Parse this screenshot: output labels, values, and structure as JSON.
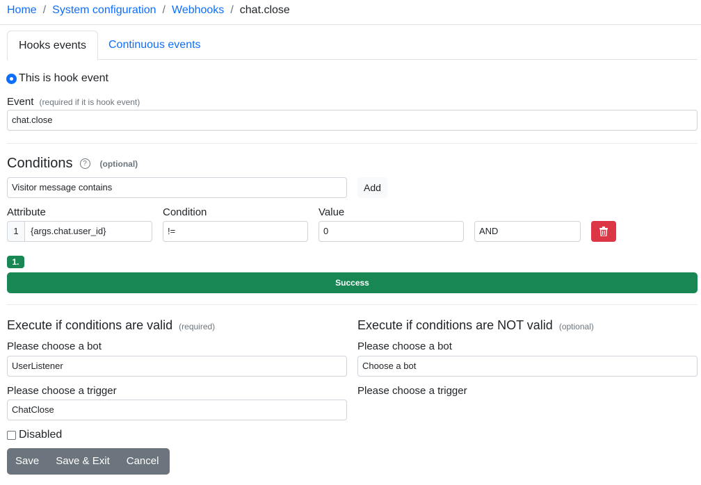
{
  "breadcrumb": {
    "items": [
      "Home",
      "System configuration",
      "Webhooks"
    ],
    "current": "chat.close"
  },
  "tabs": [
    {
      "label": "Hooks events",
      "active": true
    },
    {
      "label": "Continuous events",
      "active": false
    }
  ],
  "hook": {
    "radio_label": "This is hook event",
    "event_label": "Event",
    "event_hint": "(required if it is hook event)",
    "event_value": "chat.close"
  },
  "conditions": {
    "title": "Conditions",
    "help_icon": "?",
    "optional": "(optional)",
    "select_value": "Visitor message contains",
    "add_label": "Add",
    "headers": {
      "attribute": "Attribute",
      "condition": "Condition",
      "value": "Value"
    },
    "row": {
      "index": "1",
      "attribute": "{args.chat.user_id}",
      "condition": "!=",
      "value": "0",
      "logic": "AND"
    },
    "badge": "1.",
    "status": "Success"
  },
  "valid": {
    "title": "Execute if conditions are valid",
    "hint": "(required)",
    "bot_label": "Please choose a bot",
    "bot_value": "UserListener",
    "trigger_label": "Please choose a trigger",
    "trigger_value": "ChatClose"
  },
  "invalid": {
    "title": "Execute if conditions are NOT valid",
    "hint": "(optional)",
    "bot_label": "Please choose a bot",
    "bot_value": "Choose a bot",
    "trigger_label": "Please choose a trigger"
  },
  "disabled_label": "Disabled",
  "actions": {
    "save": "Save",
    "save_exit": "Save & Exit",
    "cancel": "Cancel"
  },
  "colors": {
    "primary": "#0d6efd",
    "success": "#198754",
    "danger": "#dc3545",
    "secondary": "#6c757d"
  }
}
